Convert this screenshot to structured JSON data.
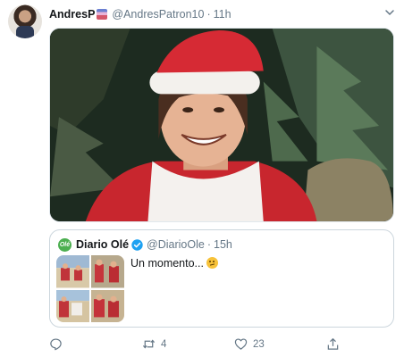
{
  "tweet": {
    "author": {
      "display_name": "AndresP",
      "handle": "@AndresPatron10"
    },
    "separator": "·",
    "time": "11h",
    "media_description_icon": "photo-santa-costume"
  },
  "quoted_tweet": {
    "author": {
      "display_name": "Diario Olé",
      "handle": "@DiarioOle",
      "logo_text": "Olé"
    },
    "separator": "·",
    "time": "15h",
    "text": "Un momento...",
    "emoji_icon": "thinking-face-icon"
  },
  "actions": {
    "reply_count": "",
    "retweet_count": "4",
    "like_count": "23"
  },
  "colors": {
    "muted": "#657786",
    "border": "#ccd6dd",
    "verified": "#1da1f2"
  }
}
